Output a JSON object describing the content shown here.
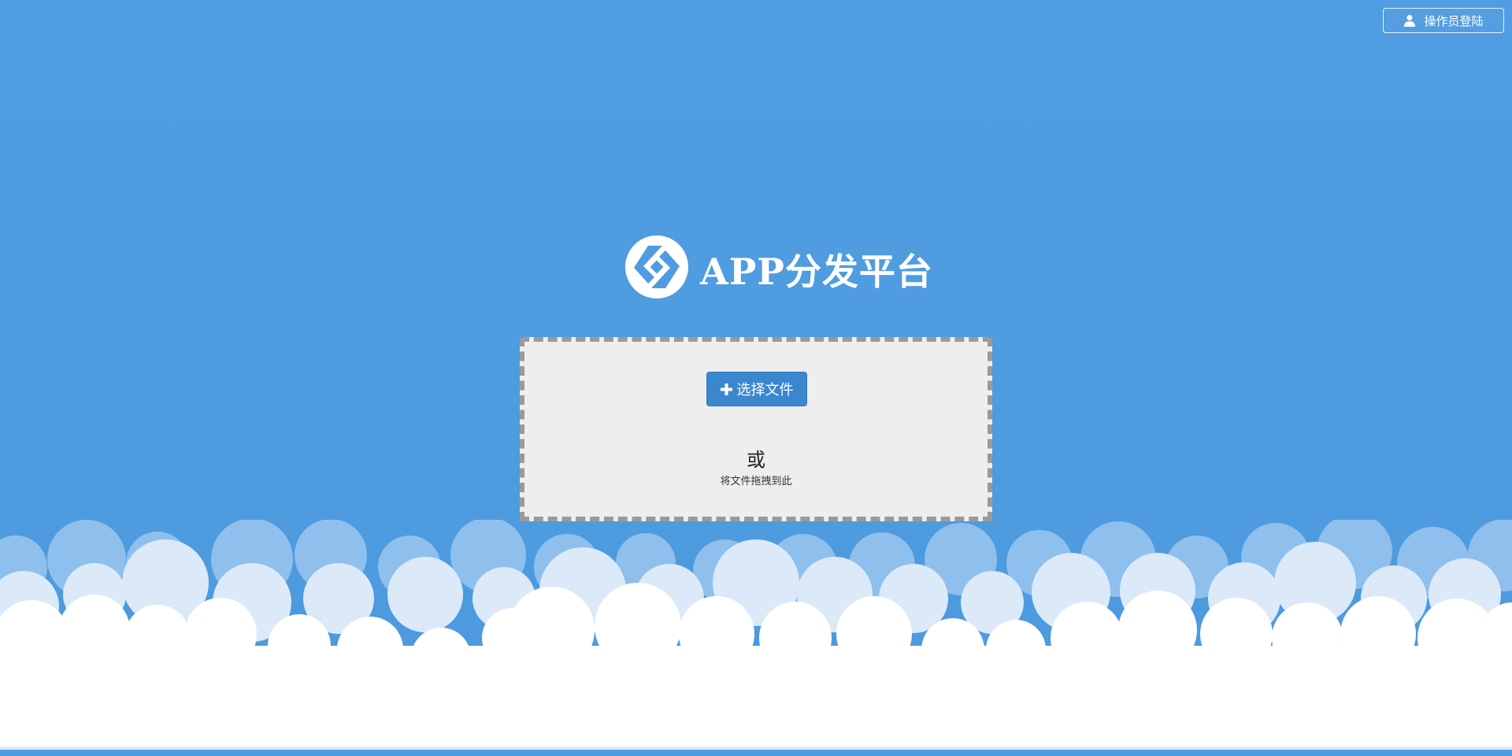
{
  "header": {
    "login_label": "操作员登陆",
    "login_icon": "user-icon"
  },
  "logo": {
    "text": "APP分发平台",
    "icon": "logo-mark-icon"
  },
  "upload": {
    "select_label": "选择文件",
    "select_icon": "plus-icon",
    "or_text": "或",
    "drag_hint": "将文件拖拽到此"
  },
  "colors": {
    "sky": "#4f9ce0",
    "button": "#3a87cf",
    "dropzone_bg": "#eeeeee",
    "dropzone_border": "#9a9a9a",
    "cloud_white": "#ffffff",
    "cloud_light": "#dbe9f8",
    "cloud_mid": "#8fbfec"
  }
}
